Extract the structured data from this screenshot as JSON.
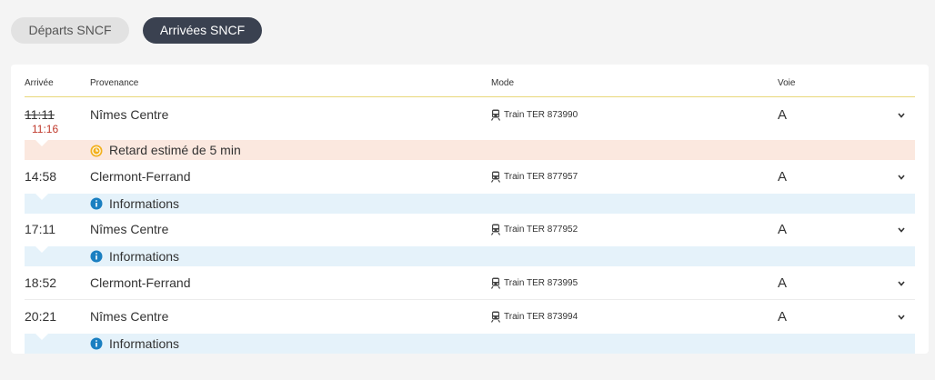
{
  "tabs": [
    {
      "label": "Départs SNCF",
      "active": false
    },
    {
      "label": "Arrivées SNCF",
      "active": true
    }
  ],
  "table": {
    "headers": {
      "arrival": "Arrivée",
      "origin": "Provenance",
      "mode": "Mode",
      "track": "Voie"
    },
    "rows": [
      {
        "time": "11:11",
        "new_time": "11:16",
        "origin": "Nîmes Centre",
        "mode": "Train TER 873990",
        "track": "A",
        "notice": "Retard estimé de 5 min",
        "notice_type": "delay"
      },
      {
        "time": "14:58",
        "origin": "Clermont-Ferrand",
        "mode": "Train TER 877957",
        "track": "A",
        "notice": "Informations",
        "notice_type": "info"
      },
      {
        "time": "17:11",
        "origin": "Nîmes Centre",
        "mode": "Train TER 877952",
        "track": "A",
        "notice": "Informations",
        "notice_type": "info"
      },
      {
        "time": "18:52",
        "origin": "Clermont-Ferrand",
        "mode": "Train TER 873995",
        "track": "A"
      },
      {
        "time": "20:21",
        "origin": "Nîmes Centre",
        "mode": "Train TER 873994",
        "track": "A",
        "notice": "Informations",
        "notice_type": "info"
      }
    ]
  },
  "colors": {
    "active_tab": "#3a4150",
    "delay_bg": "#fbe8df",
    "info_bg": "#e5f2fa",
    "delay_icon": "#f2b01e",
    "info_icon": "#1a7fc1",
    "late_time": "#c0392b"
  },
  "icons": {
    "mode": "train-icon",
    "expand": "chevron-down-icon",
    "delay": "clock-icon",
    "info": "info-icon"
  }
}
